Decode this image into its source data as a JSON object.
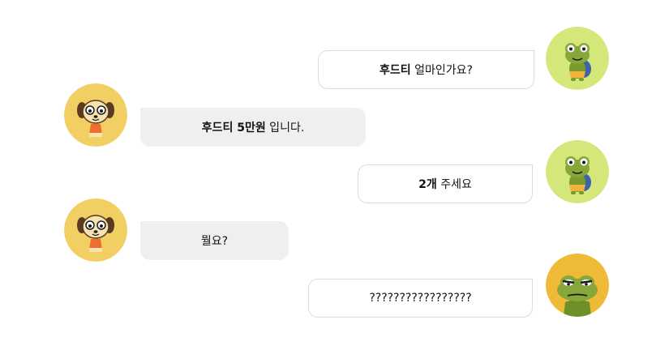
{
  "colors": {
    "frog_avatar_bg": "#d3e77a",
    "dog_avatar_bg": "#f2cf63",
    "angry_frog_avatar_bg": "#efbb36",
    "sent_bubble_border": "#dcdcdc",
    "recv_bubble_bg": "#efefef"
  },
  "messages": [
    {
      "side": "sent",
      "avatar": "frog-icon",
      "bold": "후드티",
      "text": " 얼마인가요?"
    },
    {
      "side": "received",
      "avatar": "dog-icon",
      "bold": "후드티 5만원",
      "text": " 입니다."
    },
    {
      "side": "sent",
      "avatar": "frog-icon",
      "bold": "2개",
      "text": " 주세요"
    },
    {
      "side": "received",
      "avatar": "dog-icon",
      "bold": "",
      "text": "뭘요?"
    },
    {
      "side": "sent",
      "avatar": "angry-frog-icon",
      "bold": "",
      "text": "?????????????????"
    }
  ]
}
